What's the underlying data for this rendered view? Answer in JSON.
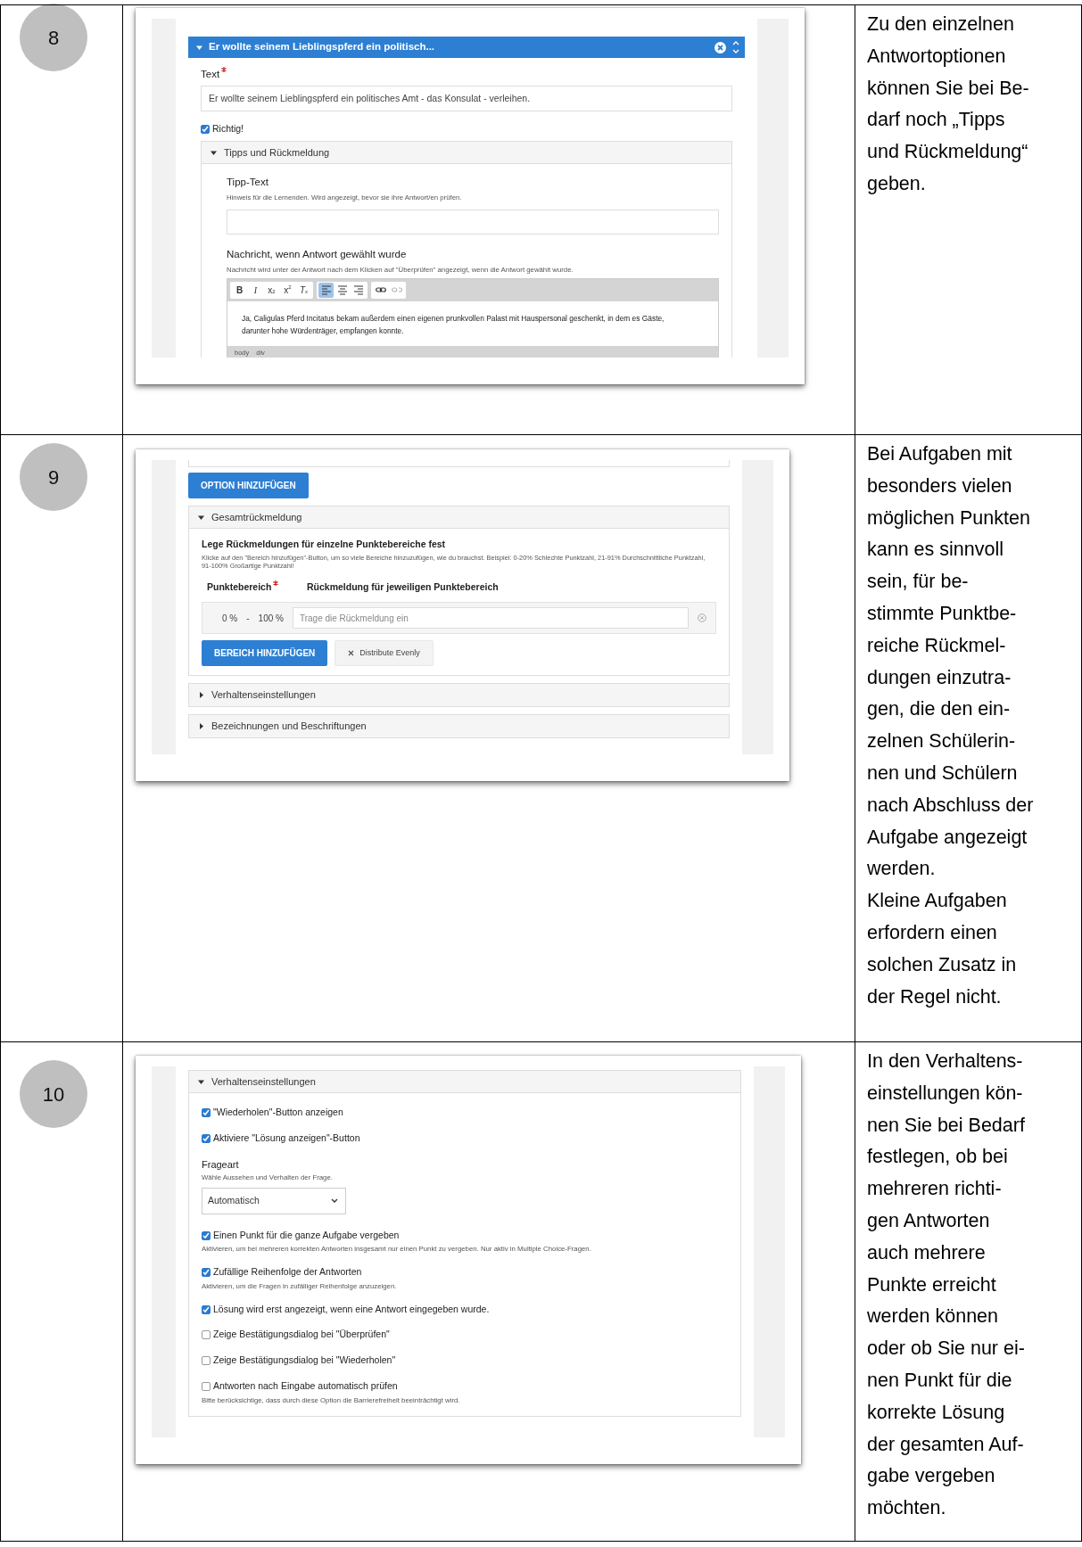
{
  "steps": [
    {
      "number": "8",
      "screenshot": {
        "kind": "answer_editor",
        "header": {
          "title": "Er wollte seinem Lieblingspferd ein politisch...",
          "expanded": true
        },
        "text_field": {
          "label": "Text",
          "required": true,
          "value": "Er wollte seinem Lieblingspferd ein politisches Amt - das Konsulat - verleihen."
        },
        "correct_checkbox": {
          "label": "Richtig!",
          "checked": true
        },
        "tips_panel": {
          "title": "Tipps und Rückmeldung",
          "expanded": true,
          "tip": {
            "label": "Tipp-Text",
            "hint": "Hinweis für die Lernenden. Wird angezeigt, bevor sie ihre Antwort/en prüfen."
          },
          "message": {
            "label": "Nachricht, wenn Antwort gewählt wurde",
            "hint": "Nachricht wird unter der Antwort nach dem Klicken auf \"Überprüfen\" angezeigt, wenn die Antwort gewählt wurde.",
            "toolbar": [
              {
                "buttons": [
                  {
                    "kind": "bold",
                    "label": "B",
                    "selected": false,
                    "disabled": false
                  },
                  {
                    "kind": "italic",
                    "label": "I",
                    "selected": false,
                    "disabled": false
                  },
                  {
                    "kind": "subscript",
                    "label": "x$_{2}$",
                    "selected": false,
                    "disabled": false
                  },
                  {
                    "kind": "superscript",
                    "label": "x$^{2}$",
                    "selected": false,
                    "disabled": false
                  },
                  {
                    "kind": "clear_format",
                    "label": "T$_{x}$",
                    "selected": false,
                    "disabled": false
                  }
                ]
              },
              {
                "buttons": [
                  {
                    "kind": "align_left",
                    "selected": true,
                    "disabled": false
                  },
                  {
                    "kind": "align_center",
                    "selected": false,
                    "disabled": false
                  },
                  {
                    "kind": "align_right",
                    "selected": false,
                    "disabled": false
                  }
                ]
              },
              {
                "buttons": [
                  {
                    "kind": "link",
                    "selected": false,
                    "disabled": false
                  },
                  {
                    "kind": "unlink",
                    "selected": false,
                    "disabled": true
                  }
                ]
              }
            ],
            "content": "Ja, Caligulas Pferd Incitatus bekam außerdem einen eigenen prunkvollen Palast mit Hauspersonal geschenkt, in dem es Gäste, darunter hohe Würdenträger, empfangen konnte.",
            "path": [
              "body",
              "div"
            ]
          }
        }
      },
      "description": [
        "Zu den einzelnen\nAntwortoptionen\nkönnen Sie bei Be-\ndarf noch „Tipps\nund Rückmeldung“\ngeben."
      ]
    },
    {
      "number": "9",
      "screenshot": {
        "kind": "overall_feedback",
        "top_button": "OPTION HINZUFÜGEN",
        "panels": [
          {
            "title": "Gesamtrückmeldung",
            "expanded": true,
            "heading": "Lege Rückmeldungen für einzelne Punktebereiche fest",
            "hint": "Klicke auf den \"Bereich hinzufügen\"-Button, um so viele Bereiche hinzuzufügen, wie du brauchst. Beispiel: 0-20% Schlechte Punktzahl, 21-91% Durchschnittliche Punktzahl, 91-100% Großartige Punktzahl!",
            "columns": [
              {
                "label": "Punktebereich",
                "required": true
              },
              {
                "label": "Rückmeldung für jeweiligen Punktebereich",
                "required": false
              }
            ],
            "ranges": [
              {
                "from": "0 %",
                "separator": "-",
                "to": "100 %",
                "placeholder": "Trage die Rückmeldung ein"
              }
            ],
            "buttons": [
              {
                "kind": "primary",
                "label": "BEREICH HINZUFÜGEN"
              },
              {
                "kind": "secondary",
                "label": "Distribute Evenly"
              }
            ]
          },
          {
            "title": "Verhaltenseinstellungen",
            "expanded": false
          },
          {
            "title": "Bezeichnungen und Beschriftungen",
            "expanded": false
          }
        ]
      },
      "description": [
        "Bei Aufgaben mit\nbesonders vielen\nmöglichen Punkten\nkann es sinnvoll\nsein, für be-\nstimmte Punktbe-\nreiche Rückmel-\ndungen einzutra-\ngen, die den ein-\nzelnen Schülerin-\nnen und Schülern\nnach Abschluss der\nAufgabe angezeigt\nwerden.",
        "Kleine Aufgaben\nerfordern einen\nsolchen Zusatz in\nder Regel nicht."
      ]
    },
    {
      "number": "10",
      "screenshot": {
        "kind": "behaviour_settings",
        "panel": {
          "title": "Verhaltenseinstellungen",
          "expanded": true,
          "fields": [
            {
              "kind": "checkbox",
              "label": "\"Wiederholen\"-Button anzeigen",
              "checked": true
            },
            {
              "kind": "checkbox",
              "label": "Aktiviere \"Lösung anzeigen\"-Button",
              "checked": true
            },
            {
              "kind": "select",
              "label": "Frageart",
              "hint": "Wähle Aussehen und Verhalten der Frage.",
              "value": "Automatisch"
            },
            {
              "kind": "checkbox",
              "label": "Einen Punkt für die ganze Aufgabe vergeben",
              "checked": true,
              "hint": "Aktivieren, um bei mehreren korrekten Antworten insgesamt nur einen Punkt zu vergeben. Nur aktiv in Multiple Choice-Fragen."
            },
            {
              "kind": "checkbox",
              "label": "Zufällige Reihenfolge der Antworten",
              "checked": true,
              "hint": "Aktivieren, um die Fragen in zufälliger Reihenfolge anzuzeigen."
            },
            {
              "kind": "checkbox",
              "label": "Lösung wird erst angezeigt, wenn eine Antwort eingegeben wurde.",
              "checked": true
            },
            {
              "kind": "checkbox",
              "label": "Zeige Bestätigungsdialog bei \"Überprüfen\"",
              "checked": false
            },
            {
              "kind": "checkbox",
              "label": "Zeige Bestätigungsdialog bei \"Wiederholen\"",
              "checked": false
            },
            {
              "kind": "checkbox",
              "label": "Antworten nach Eingabe automatisch prüfen",
              "checked": false,
              "hint": "Bitte berücksichtige, dass durch diese Option die Barrierefreiheit beeinträchtigt wird."
            }
          ]
        }
      },
      "description": [
        "In den Verhaltens-\neinstellungen kön-\nnen Sie bei Bedarf\nfestlegen, ob bei\nmehreren richti-\ngen Antworten\nauch mehrere\nPunkte erreicht\nwerden können\noder ob Sie nur ei-\nnen Punkt für die\nkorrekte Lösung\nder gesamten Auf-\ngabe vergeben\nmöchten."
      ]
    }
  ]
}
